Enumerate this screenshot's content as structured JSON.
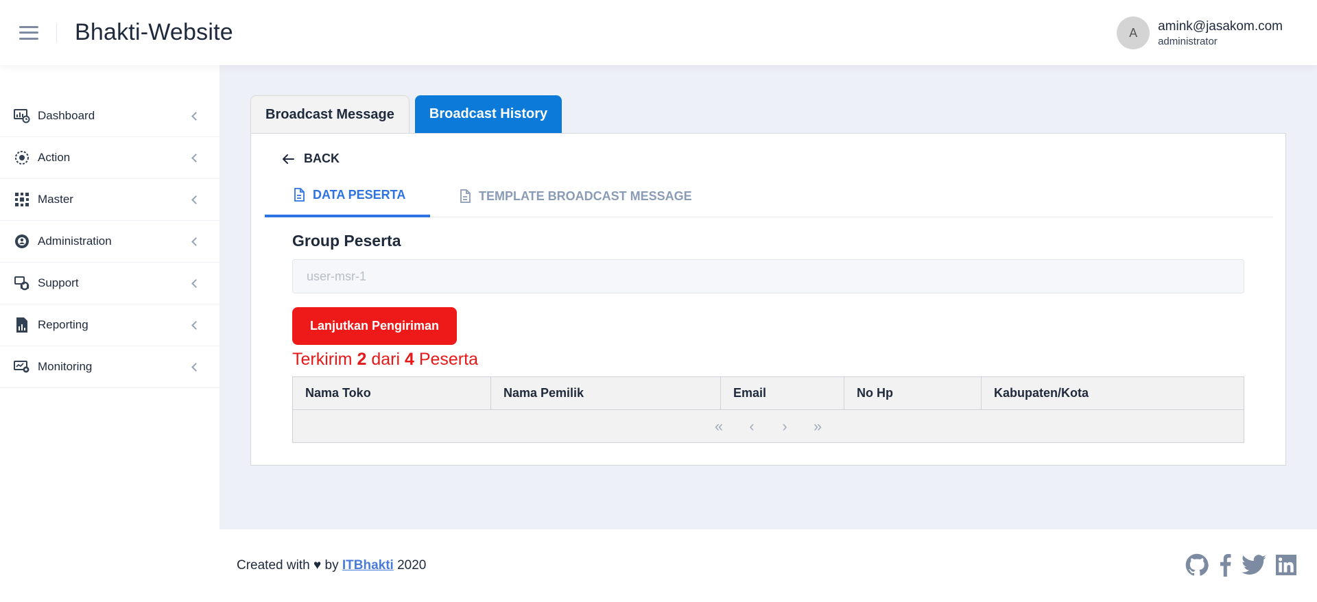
{
  "header": {
    "title": "Bhakti-Website",
    "user": {
      "avatar_letter": "A",
      "email": "amink@jasakom.com",
      "role": "administrator"
    }
  },
  "sidebar": {
    "items": [
      {
        "label": "Dashboard",
        "icon": "dashboard-icon"
      },
      {
        "label": "Action",
        "icon": "action-icon"
      },
      {
        "label": "Master",
        "icon": "master-icon"
      },
      {
        "label": "Administration",
        "icon": "administration-icon"
      },
      {
        "label": "Support",
        "icon": "support-icon"
      },
      {
        "label": "Reporting",
        "icon": "reporting-icon"
      },
      {
        "label": "Monitoring",
        "icon": "monitoring-icon"
      }
    ]
  },
  "tabs": [
    {
      "label": "Broadcast Message",
      "active": false
    },
    {
      "label": "Broadcast History",
      "active": true
    }
  ],
  "card": {
    "back_label": "BACK",
    "subtabs": [
      {
        "label": "DATA PESERTA",
        "active": true
      },
      {
        "label": "TEMPLATE BROADCAST MESSAGE",
        "active": false
      }
    ],
    "group_label": "Group Peserta",
    "group_value": "user-msr-1",
    "send_button": "Lanjutkan Pengiriman",
    "status": {
      "prefix": "Terkirim",
      "sent": "2",
      "middle": "dari",
      "total": "4",
      "suffix": "Peserta"
    },
    "table": {
      "columns": [
        "Nama Toko",
        "Nama Pemilik",
        "Email",
        "No Hp",
        "Kabupaten/Kota"
      ],
      "rows": [],
      "pager": [
        "«",
        "‹",
        "›",
        "»"
      ]
    }
  },
  "footer": {
    "prefix": "Created with ♥ by",
    "link": "ITBhakti",
    "year": "2020",
    "social": [
      "github-icon",
      "facebook-icon",
      "twitter-icon",
      "linkedin-icon"
    ]
  },
  "colors": {
    "primary_tab": "#0b7ad8",
    "subtab_active": "#2d73e2",
    "danger": "#ee1a1a",
    "status_text": "#e71818",
    "background": "#edf0f6"
  }
}
